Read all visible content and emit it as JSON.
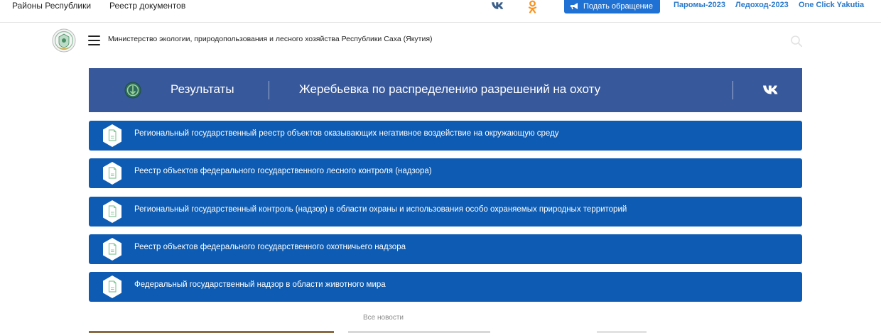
{
  "topbar": {
    "districts": "Районы Республики",
    "registry": "Реестр документов",
    "appeal_button": "Подать обращение",
    "links": [
      "Паромы-2023",
      "Ледоход-2023",
      "One Click Yakutia"
    ]
  },
  "header": {
    "ministry_name": "Министерство экологии, природопользования и лесного хозяйства Республики Саха (Якутия)"
  },
  "banner": {
    "results": "Результаты",
    "title": "Жеребьевка по распределению разрешений на охоту"
  },
  "registries": [
    {
      "label": "Региональный государственный реестр объектов оказывающих негативное воздействие на окружающую среду"
    },
    {
      "label": "Реестр объектов федерального государственного лесного контроля (надзора)"
    },
    {
      "label": "Региональный государственный контроль (надзор) в области охраны и использования особо охраняемых природных территорий"
    },
    {
      "label": "Реестр объектов федерального государственного охотничьего надзора"
    },
    {
      "label": "Федеральный государственный надзор в области животного мира"
    }
  ],
  "all_news": "Все новости",
  "colors": {
    "banner": "#37589a",
    "registry_item": "#0d5bb2",
    "appeal_button": "#1f72d3",
    "toplink": "#2a79c9",
    "ok_orange": "#f7931e",
    "vk_blue": "#3b5f8a"
  }
}
